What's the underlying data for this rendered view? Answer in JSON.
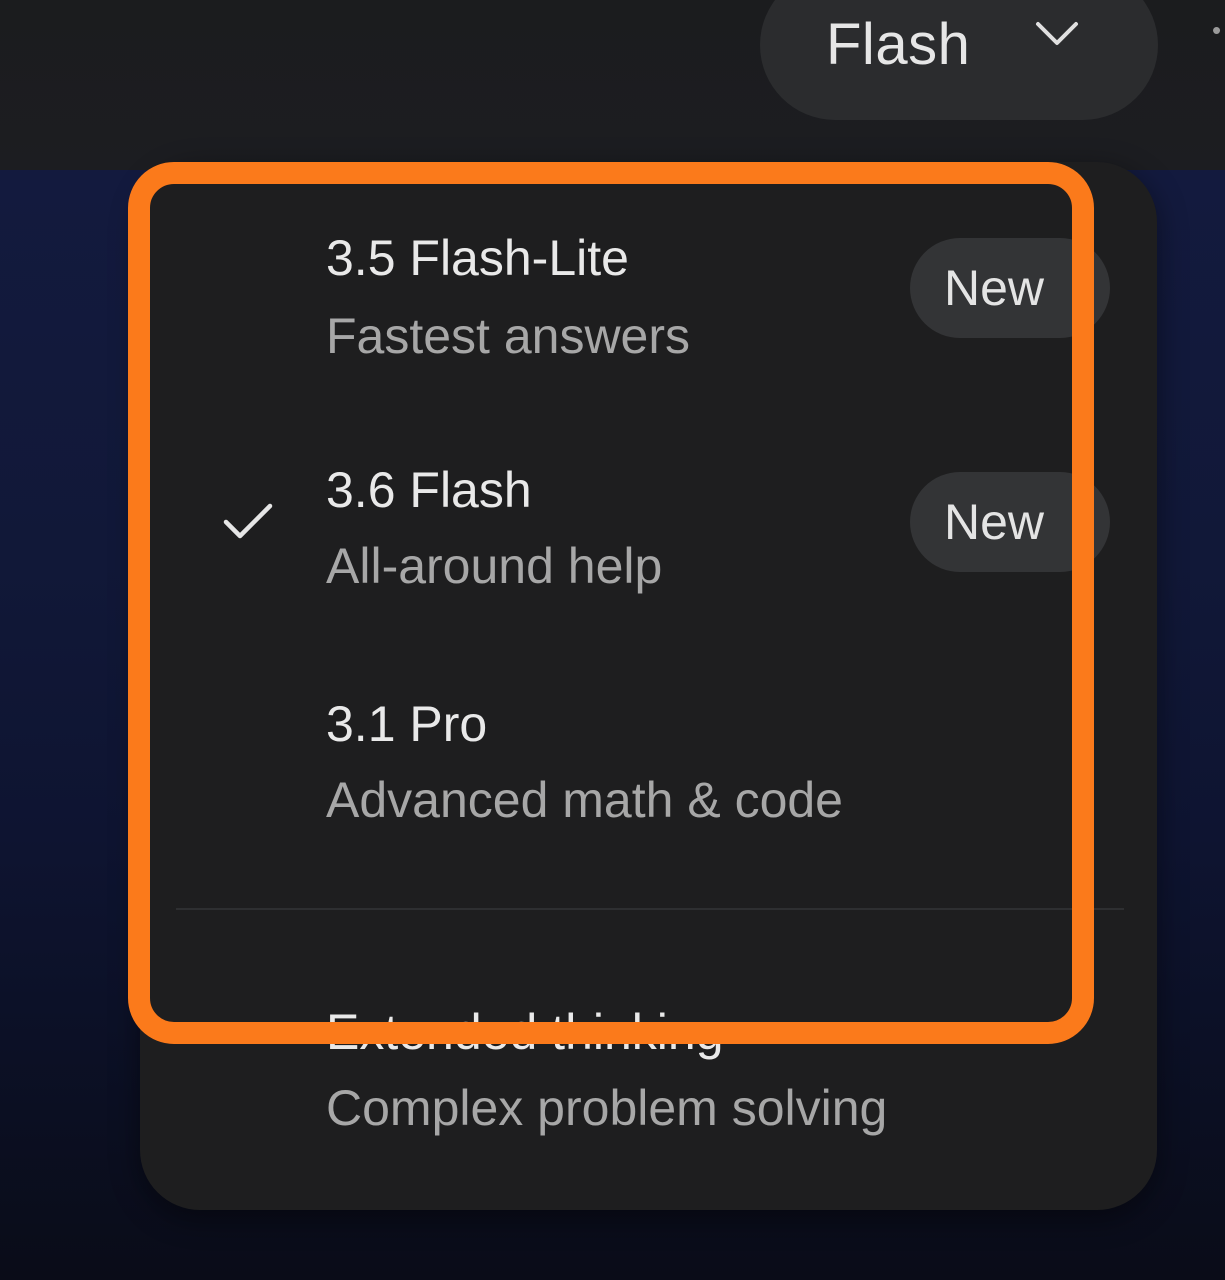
{
  "header": {
    "model_switcher_label": "Flash"
  },
  "menu": {
    "items": [
      {
        "title": "3.5 Flash-Lite",
        "subtitle": "Fastest answers",
        "badge": "New",
        "selected": false
      },
      {
        "title": "3.6 Flash",
        "subtitle": "All-around help",
        "badge": "New",
        "selected": true
      },
      {
        "title": "3.1 Pro",
        "subtitle": "Advanced math & code",
        "badge": "",
        "selected": false
      },
      {
        "title": "Extended thinking",
        "subtitle": "Complex problem solving",
        "badge": "",
        "selected": false
      }
    ]
  },
  "colors": {
    "highlight": "#fb7a1b",
    "menu_background": "#1e1e1f",
    "badge_background": "#333436",
    "page_background": "#131a3e"
  },
  "icons": {
    "selected": "check-icon",
    "switcher": "chevron-down-icon"
  }
}
